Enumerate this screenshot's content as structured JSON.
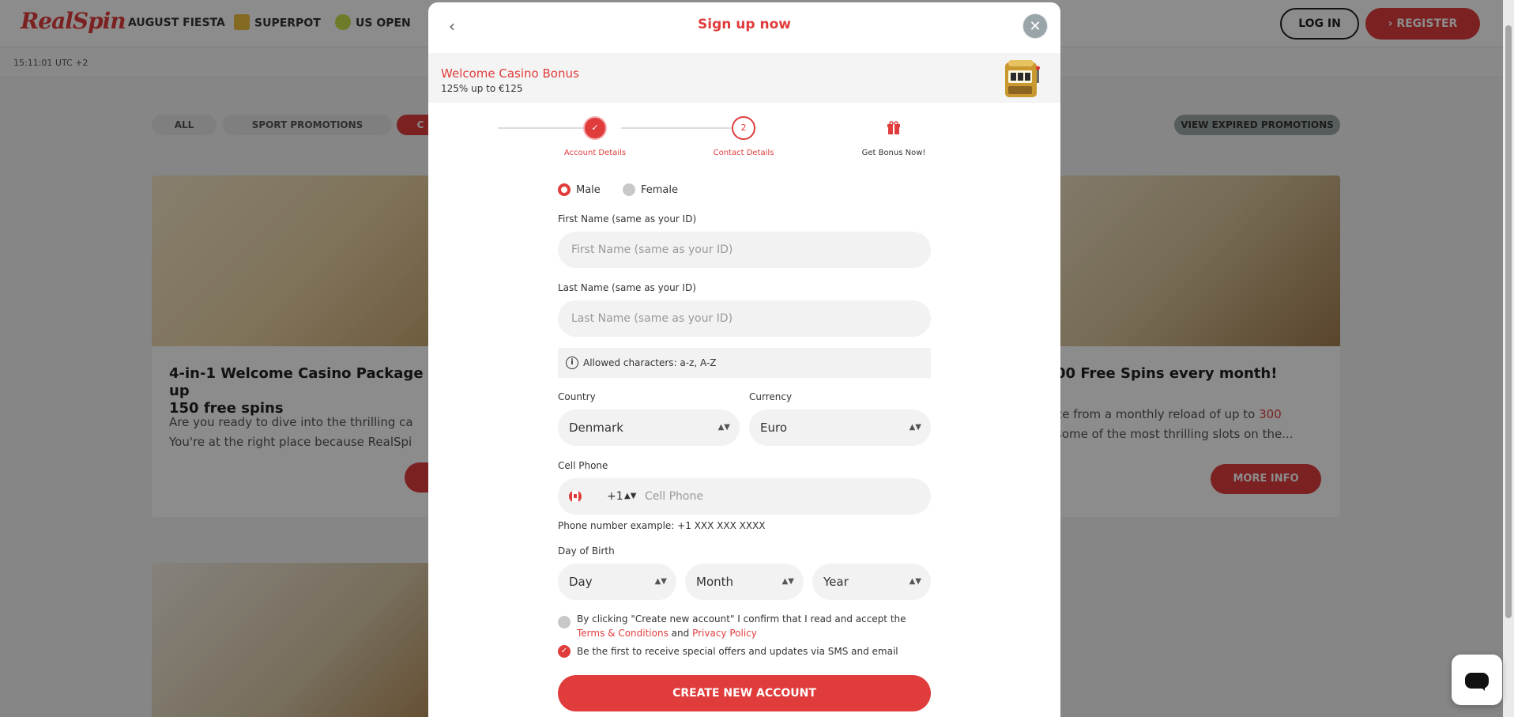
{
  "site": {
    "logo": "RealSpin",
    "nav": [
      "AUGUST FIESTA",
      "SUPERPOT",
      "US OPEN"
    ],
    "login": "LOG IN",
    "register": "REGISTER",
    "timestamp": "15:11:01 UTC +2",
    "filters": [
      "ALL",
      "SPORT PROMOTIONS",
      "C"
    ],
    "view_expired": "VIEW EXPIRED PROMOTIONS",
    "cards": [
      {
        "title_line1": "4-in-1 Welcome Casino Package up",
        "title_line2": "150 free spins",
        "text_line1": "Are you ready to dive into the thrilling ca",
        "text_line2": "You're at the right place because RealSpi"
      },
      {
        "title": "00 Free Spins every month!",
        "text_line1": "ce from a monthly reload of up to",
        "highlight": "300",
        "text_line2": "some of the most thrilling slots on the...",
        "button": "MORE INFO"
      }
    ]
  },
  "modal": {
    "title": "Sign up now",
    "bonus_title": "Welcome Casino Bonus",
    "bonus_sub": "125% up to €125",
    "steps": [
      {
        "label": "Account Details",
        "state": "done"
      },
      {
        "label": "Contact Details",
        "number": "2",
        "state": "current"
      },
      {
        "label": "Get Bonus Now!",
        "state": "pending",
        "icon": "gift-icon"
      }
    ],
    "gender": {
      "male": "Male",
      "female": "Female",
      "selected": "Male"
    },
    "first_name": {
      "label": "First Name (same as your ID)",
      "placeholder": "First Name  (same as your ID)"
    },
    "last_name": {
      "label": "Last Name (same as your ID)",
      "placeholder": "Last Name (same as your ID)"
    },
    "allowed_chars": "Allowed characters: a-z, A-Z",
    "country": {
      "label": "Country",
      "value": "Denmark"
    },
    "currency": {
      "label": "Currency",
      "value": "Euro"
    },
    "phone": {
      "label": "Cell Phone",
      "code": "+1",
      "placeholder": "Cell Phone",
      "example": "Phone number example: +1 XXX XXX XXXX"
    },
    "dob": {
      "label": "Day of Birth",
      "day": "Day",
      "month": "Month",
      "year": "Year"
    },
    "terms": {
      "text1": "By clicking \"Create new account\" I confirm that I read and accept the",
      "terms_link": "Terms & Conditions",
      "and": "and",
      "privacy_link": "Privacy Policy",
      "checked": false
    },
    "offers": {
      "text": "Be the first to receive special offers and updates via SMS and email",
      "checked": true
    },
    "submit": "CREATE NEW ACCOUNT"
  },
  "colors": {
    "accent": "#e03c3c",
    "overlay": "rgba(0,0,0,0.45)"
  }
}
